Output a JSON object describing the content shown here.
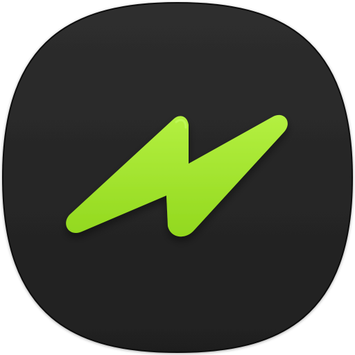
{
  "icon": {
    "semantic": "lightning-bolt-icon",
    "colors": {
      "tile_top": "#2e2e2e",
      "tile_bottom": "#1f1f1f",
      "tile_edge": "#0d0d0d",
      "bolt_top": "#b4f041",
      "bolt_bottom": "#92d81e",
      "bolt_highlight": "#c9ff6a"
    }
  }
}
